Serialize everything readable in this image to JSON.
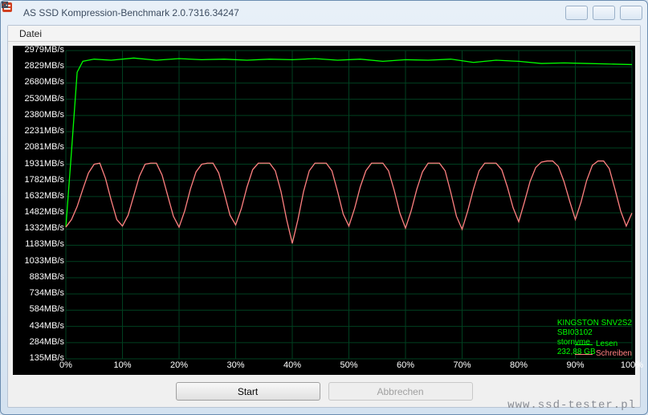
{
  "window": {
    "title": "AS SSD Kompression-Benchmark 2.0.7316.34247"
  },
  "menu": {
    "file": "Datei"
  },
  "buttons": {
    "start": "Start",
    "cancel": "Abbrechen"
  },
  "device": {
    "name": "KINGSTON SNV2S2",
    "driver": "SBI03102",
    "driver2": "stornvme",
    "capacity": "232,88 GB"
  },
  "legend": {
    "read": "Lesen",
    "write": "Schreiben",
    "read_color": "#00ff00",
    "write_color": "#ff8080"
  },
  "watermark": "www.ssd-tester.pl",
  "chart_data": {
    "type": "line",
    "xlabel": "",
    "ylabel": "",
    "ylim": [
      135,
      2979
    ],
    "xlim": [
      0,
      100
    ],
    "y_ticks": [
      "2979MB/s",
      "2829MB/s",
      "2680MB/s",
      "2530MB/s",
      "2380MB/s",
      "2231MB/s",
      "2081MB/s",
      "1931MB/s",
      "1782MB/s",
      "1632MB/s",
      "1482MB/s",
      "1332MB/s",
      "1183MB/s",
      "1033MB/s",
      "883MB/s",
      "734MB/s",
      "584MB/s",
      "434MB/s",
      "284MB/s",
      "135MB/s"
    ],
    "x_ticks": [
      "0%",
      "10%",
      "20%",
      "30%",
      "40%",
      "50%",
      "60%",
      "70%",
      "80%",
      "90%",
      "100%"
    ],
    "series": [
      {
        "name": "Lesen",
        "color": "#00ff00",
        "x": [
          0,
          1,
          2,
          3,
          5,
          8,
          12,
          16,
          20,
          24,
          28,
          32,
          36,
          40,
          44,
          48,
          52,
          56,
          60,
          64,
          68,
          72,
          76,
          80,
          84,
          88,
          92,
          96,
          100
        ],
        "y": [
          1350,
          2050,
          2780,
          2880,
          2900,
          2890,
          2910,
          2890,
          2905,
          2895,
          2900,
          2890,
          2900,
          2895,
          2905,
          2890,
          2900,
          2880,
          2895,
          2890,
          2900,
          2870,
          2890,
          2880,
          2860,
          2865,
          2860,
          2855,
          2850
        ]
      },
      {
        "name": "Schreiben",
        "color": "#ff8080",
        "x": [
          0,
          1,
          2,
          3,
          4,
          5,
          6,
          7,
          8,
          9,
          10,
          11,
          12,
          13,
          14,
          15,
          16,
          17,
          18,
          19,
          20,
          21,
          22,
          23,
          24,
          25,
          26,
          27,
          28,
          29,
          30,
          31,
          32,
          33,
          34,
          35,
          36,
          37,
          38,
          39,
          40,
          41,
          42,
          43,
          44,
          45,
          46,
          47,
          48,
          49,
          50,
          51,
          52,
          53,
          54,
          55,
          56,
          57,
          58,
          59,
          60,
          61,
          62,
          63,
          64,
          65,
          66,
          67,
          68,
          69,
          70,
          71,
          72,
          73,
          74,
          75,
          76,
          77,
          78,
          79,
          80,
          81,
          82,
          83,
          84,
          85,
          86,
          87,
          88,
          89,
          90,
          91,
          92,
          93,
          94,
          95,
          96,
          97,
          98,
          99,
          100
        ],
        "y": [
          1350,
          1420,
          1540,
          1700,
          1850,
          1930,
          1940,
          1800,
          1600,
          1420,
          1360,
          1460,
          1640,
          1820,
          1930,
          1940,
          1940,
          1830,
          1640,
          1450,
          1350,
          1500,
          1700,
          1860,
          1930,
          1940,
          1940,
          1850,
          1660,
          1460,
          1370,
          1520,
          1720,
          1880,
          1940,
          1940,
          1940,
          1870,
          1680,
          1420,
          1200,
          1420,
          1680,
          1870,
          1940,
          1940,
          1940,
          1870,
          1680,
          1470,
          1360,
          1520,
          1720,
          1870,
          1940,
          1940,
          1940,
          1870,
          1690,
          1480,
          1340,
          1500,
          1700,
          1860,
          1940,
          1940,
          1940,
          1870,
          1670,
          1450,
          1330,
          1500,
          1700,
          1870,
          1940,
          1940,
          1940,
          1880,
          1720,
          1530,
          1400,
          1580,
          1770,
          1900,
          1950,
          1960,
          1960,
          1910,
          1770,
          1590,
          1420,
          1580,
          1780,
          1920,
          1960,
          1960,
          1890,
          1700,
          1500,
          1360,
          1480
        ]
      }
    ]
  }
}
